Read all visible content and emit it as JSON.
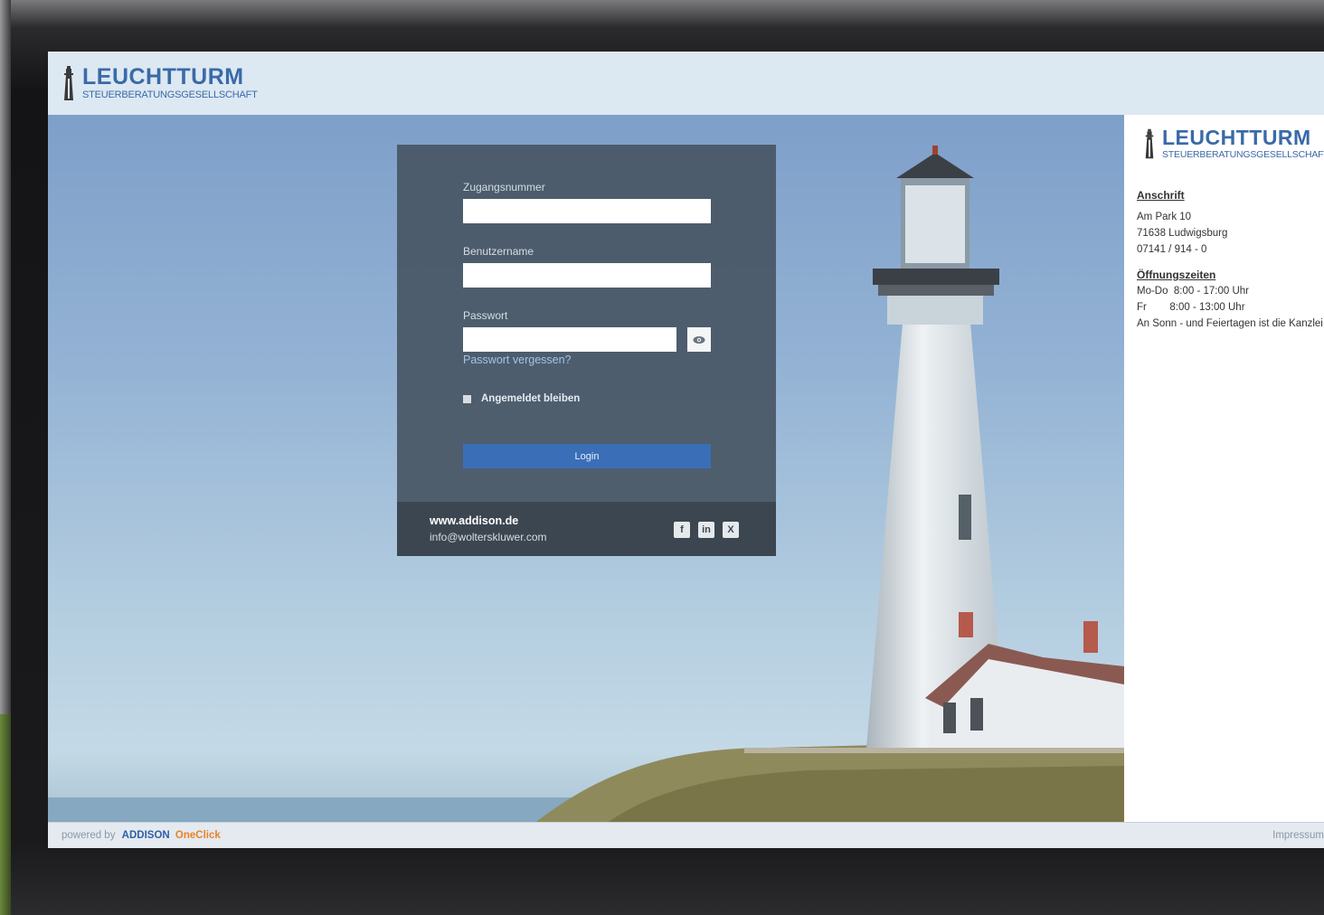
{
  "brand": {
    "name": "LEUCHTTURM",
    "subtitle": "STEUERBERATUNGSGESELLSCHAFT",
    "color": "#3a6aa8"
  },
  "login": {
    "fields": {
      "access_number_label": "Zugangsnummer",
      "access_number_value": "",
      "username_label": "Benutzername",
      "username_value": "",
      "password_label": "Passwort",
      "password_value": ""
    },
    "forgot_password": "Passwort vergessen?",
    "remember_me": "Angemeldet bleiben",
    "login_button": "Login",
    "footer": {
      "website": "www.addison.de",
      "email": "info@wolterskluwer.com",
      "social_icons": [
        "facebook-icon",
        "linkedin-icon",
        "xing-icon"
      ]
    }
  },
  "info": {
    "address_heading": "Anschrift",
    "address_lines": [
      "Am Park 10",
      "71638 Ludwigsburg",
      "07141 / 914 - 0"
    ],
    "hours_heading": "Öffnungszeiten",
    "hours_lines": [
      "Mo-Do  8:00 - 17:00 Uhr",
      "Fr        8:00 - 13:00 Uhr",
      "An Sonn - und Feiertagen ist die Kanzlei geschlossen"
    ]
  },
  "footer": {
    "powered_by": "powered by",
    "addison": "ADDISON",
    "oneclick": "OneClick",
    "imprint": "Impressum"
  },
  "colors": {
    "accent_blue": "#3a6fb8",
    "oneclick_orange": "#e8832a",
    "panel": "#485664"
  }
}
